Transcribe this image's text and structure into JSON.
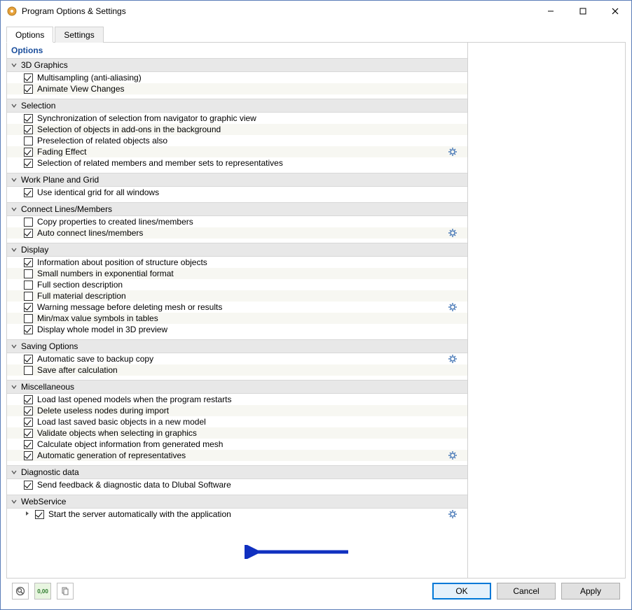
{
  "window": {
    "title": "Program Options & Settings"
  },
  "tabs": [
    {
      "label": "Options",
      "active": true
    },
    {
      "label": "Settings",
      "active": false
    }
  ],
  "sectionTitle": "Options",
  "groups": [
    {
      "name": "3D Graphics",
      "expanded": true,
      "items": [
        {
          "label": "Multisampling (anti-aliasing)",
          "checked": true,
          "gear": false
        },
        {
          "label": "Animate View Changes",
          "checked": true,
          "gear": false
        }
      ]
    },
    {
      "name": "Selection",
      "expanded": true,
      "items": [
        {
          "label": "Synchronization of selection from navigator to graphic view",
          "checked": true,
          "gear": false
        },
        {
          "label": "Selection of objects in add-ons in the background",
          "checked": true,
          "gear": false
        },
        {
          "label": "Preselection of related objects also",
          "checked": false,
          "gear": false
        },
        {
          "label": "Fading Effect",
          "checked": true,
          "gear": true
        },
        {
          "label": "Selection of related members and member sets to representatives",
          "checked": true,
          "gear": false
        }
      ]
    },
    {
      "name": "Work Plane and Grid",
      "expanded": true,
      "items": [
        {
          "label": "Use identical grid for all windows",
          "checked": true,
          "gear": false
        }
      ]
    },
    {
      "name": "Connect Lines/Members",
      "expanded": true,
      "items": [
        {
          "label": "Copy properties to created lines/members",
          "checked": false,
          "gear": false
        },
        {
          "label": "Auto connect lines/members",
          "checked": true,
          "gear": true
        }
      ]
    },
    {
      "name": "Display",
      "expanded": true,
      "items": [
        {
          "label": "Information about position of structure objects",
          "checked": true,
          "gear": false
        },
        {
          "label": "Small numbers in exponential format",
          "checked": false,
          "gear": false
        },
        {
          "label": "Full section description",
          "checked": false,
          "gear": false
        },
        {
          "label": "Full material description",
          "checked": false,
          "gear": false
        },
        {
          "label": "Warning message before deleting mesh or results",
          "checked": true,
          "gear": true
        },
        {
          "label": "Min/max value symbols in tables",
          "checked": false,
          "gear": false
        },
        {
          "label": "Display whole model in 3D preview",
          "checked": true,
          "gear": false
        }
      ]
    },
    {
      "name": "Saving Options",
      "expanded": true,
      "items": [
        {
          "label": "Automatic save to backup copy",
          "checked": true,
          "gear": true
        },
        {
          "label": "Save after calculation",
          "checked": false,
          "gear": false
        }
      ]
    },
    {
      "name": "Miscellaneous",
      "expanded": true,
      "items": [
        {
          "label": "Load last opened models when the program restarts",
          "checked": true,
          "gear": false
        },
        {
          "label": "Delete useless nodes during import",
          "checked": true,
          "gear": false
        },
        {
          "label": "Load last saved basic objects in a new model",
          "checked": true,
          "gear": false
        },
        {
          "label": "Validate objects when selecting in graphics",
          "checked": true,
          "gear": false
        },
        {
          "label": "Calculate object information from generated mesh",
          "checked": true,
          "gear": false
        },
        {
          "label": "Automatic generation of representatives",
          "checked": true,
          "gear": true
        }
      ]
    },
    {
      "name": "Diagnostic data",
      "expanded": true,
      "items": [
        {
          "label": "Send feedback & diagnostic data to Dlubal Software",
          "checked": true,
          "gear": false
        }
      ]
    },
    {
      "name": "WebService",
      "expanded": true,
      "items": [
        {
          "label": "Start the server automatically with the application",
          "checked": true,
          "gear": true,
          "hasSub": true
        }
      ]
    }
  ],
  "footer": {
    "ok": "OK",
    "cancel": "Cancel",
    "apply": "Apply"
  }
}
